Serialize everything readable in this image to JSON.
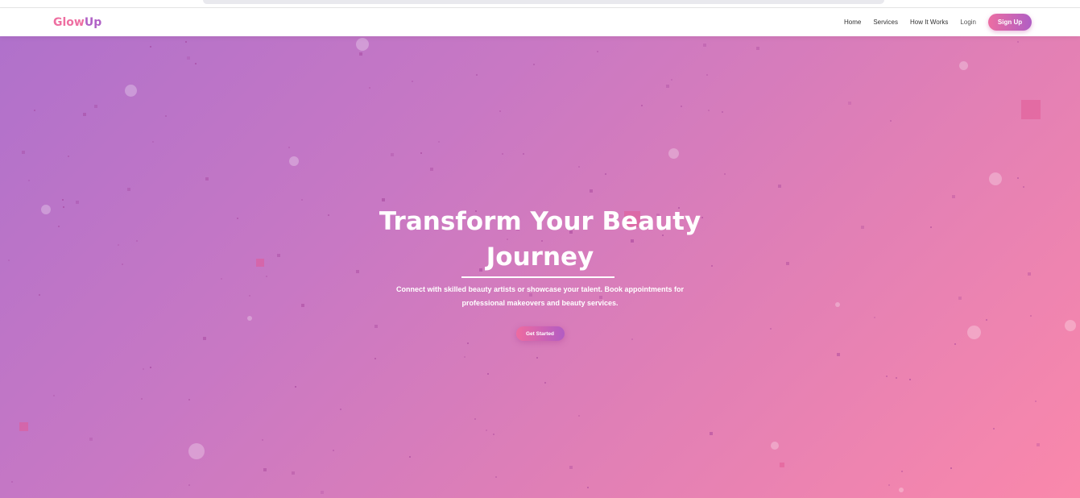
{
  "brand": {
    "logo_part1": "Glow",
    "logo_part2": "Up"
  },
  "nav": {
    "links": [
      "Home",
      "Services",
      "How It Works",
      "Login"
    ],
    "signup_label": "Sign Up"
  },
  "hero": {
    "title": "Transform Your Beauty Journey",
    "subtitle": "Connect with skilled beauty artists or showcase your talent. Book appointments for professional makeovers and beauty services.",
    "cta_label": "Get Started"
  },
  "colors": {
    "gradient_start": "#b071cb",
    "gradient_end": "#fa88ab",
    "accent_pink": "#ec6da2",
    "accent_purple": "#b05ec4"
  }
}
